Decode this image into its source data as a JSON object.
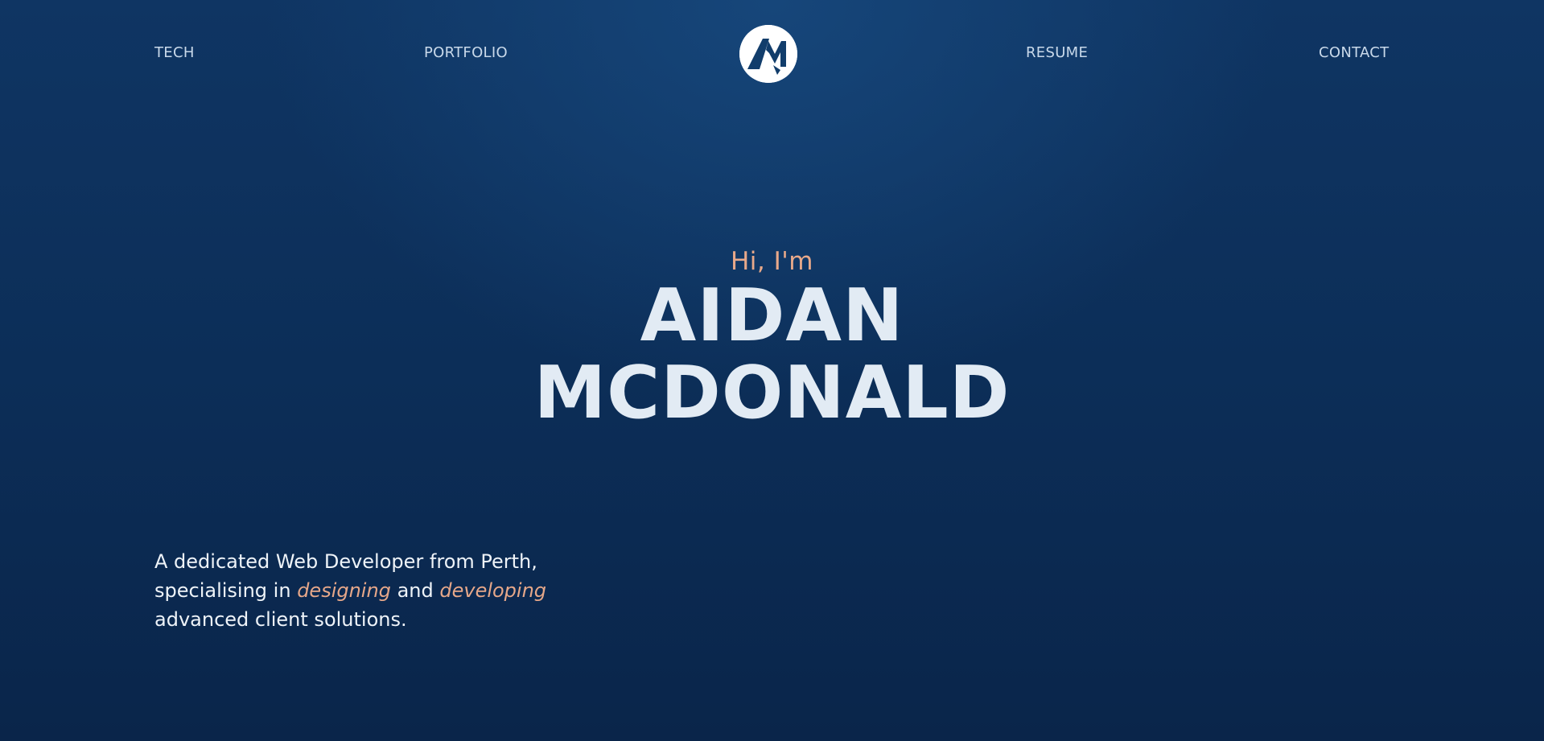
{
  "nav": {
    "links": [
      "TECH",
      "PORTFOLIO",
      "RESUME",
      "CONTACT"
    ],
    "logo_icon": "am-monogram-logo-icon"
  },
  "hero": {
    "greeting": "Hi, I'm",
    "first_name": "AIDAN",
    "last_name": "MCDONALD"
  },
  "intro": {
    "part1": "A dedicated Web Developer from Perth,",
    "part2": "specialising in",
    "highlight1": "designing",
    "part3": "and",
    "highlight2": "developing",
    "part4": "advanced client solutions."
  },
  "colors": {
    "background": "#0f3563",
    "accent": "#e8a98a",
    "heading": "#e2ebf4",
    "nav_text": "#c9d9ea"
  }
}
